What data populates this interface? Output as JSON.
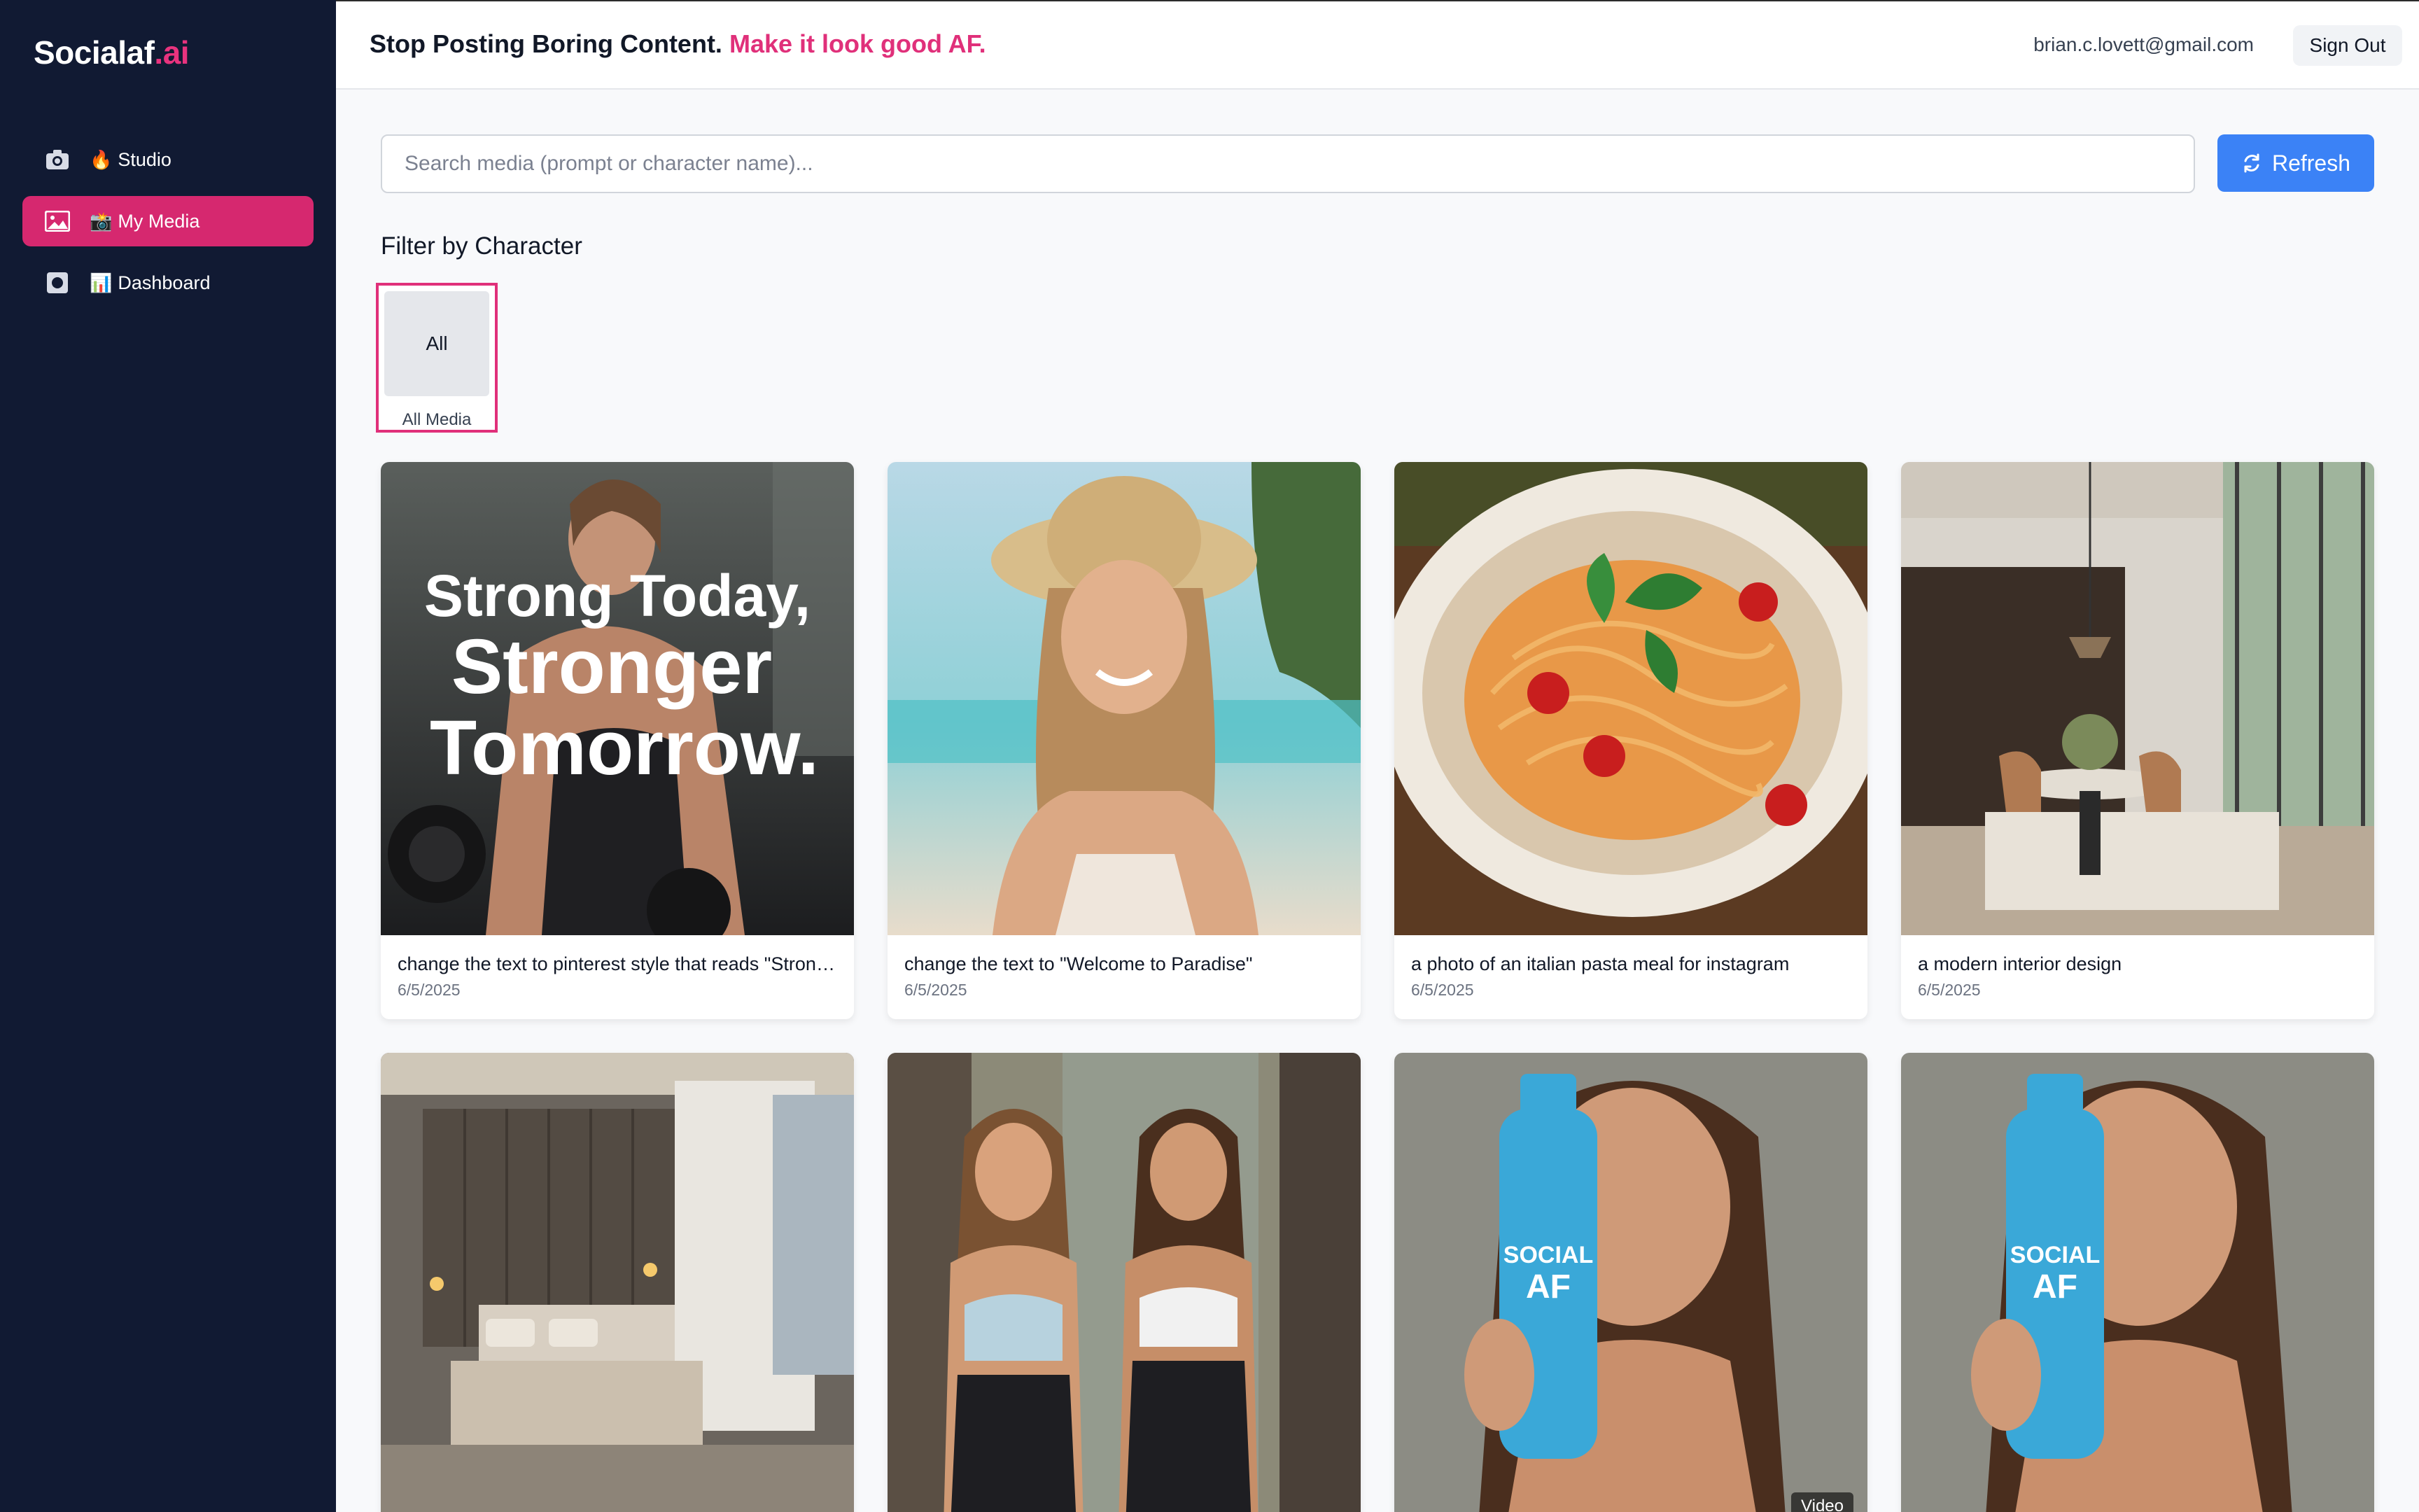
{
  "app": {
    "logo_main": "Socialaf",
    "logo_accent": ".ai"
  },
  "sidebar": {
    "items": [
      {
        "emoji": "🔥",
        "label": "Studio",
        "icon": "camera-icon",
        "active": false
      },
      {
        "emoji": "📸",
        "label": "My Media",
        "icon": "image-icon",
        "active": true
      },
      {
        "emoji": "📊",
        "label": "Dashboard",
        "icon": "square-dot-icon",
        "active": false
      }
    ]
  },
  "header": {
    "headline": "Stop Posting Boring Content.",
    "headline_accent": "Make it look good AF.",
    "user_email": "brian.c.lovett@gmail.com",
    "signout_label": "Sign Out"
  },
  "search": {
    "placeholder": "Search media (prompt or character name)...",
    "value": ""
  },
  "refresh": {
    "label": "Refresh",
    "icon": "refresh-icon"
  },
  "filter": {
    "title": "Filter by Character",
    "chips": [
      {
        "box_label": "All",
        "label": "All Media",
        "selected": true
      }
    ]
  },
  "media": [
    {
      "caption": "change the text to pinterest style that reads \"Strong Today, Stronger Tomorrow.\"",
      "date": "6/5/2025",
      "overlay_text": [
        "Strong Today,",
        "Stronger",
        "Tomorrow."
      ]
    },
    {
      "caption": "change the text to \"Welcome to Paradise\"",
      "date": "6/5/2025"
    },
    {
      "caption": "a photo of an italian pasta meal for instagram",
      "date": "6/5/2025"
    },
    {
      "caption": "a modern interior design",
      "date": "6/5/2025"
    },
    {
      "caption": "",
      "date": ""
    },
    {
      "caption": "",
      "date": ""
    },
    {
      "caption": "",
      "date": "",
      "badge": "Video",
      "product_text": [
        "SOCIAL",
        "AF"
      ]
    },
    {
      "caption": "",
      "date": "",
      "product_text": [
        "SOCIAL",
        "AF"
      ]
    }
  ],
  "colors": {
    "sidebar_bg": "#111a33",
    "accent_pink": "#e0307a",
    "refresh_blue": "#3b82f6"
  }
}
